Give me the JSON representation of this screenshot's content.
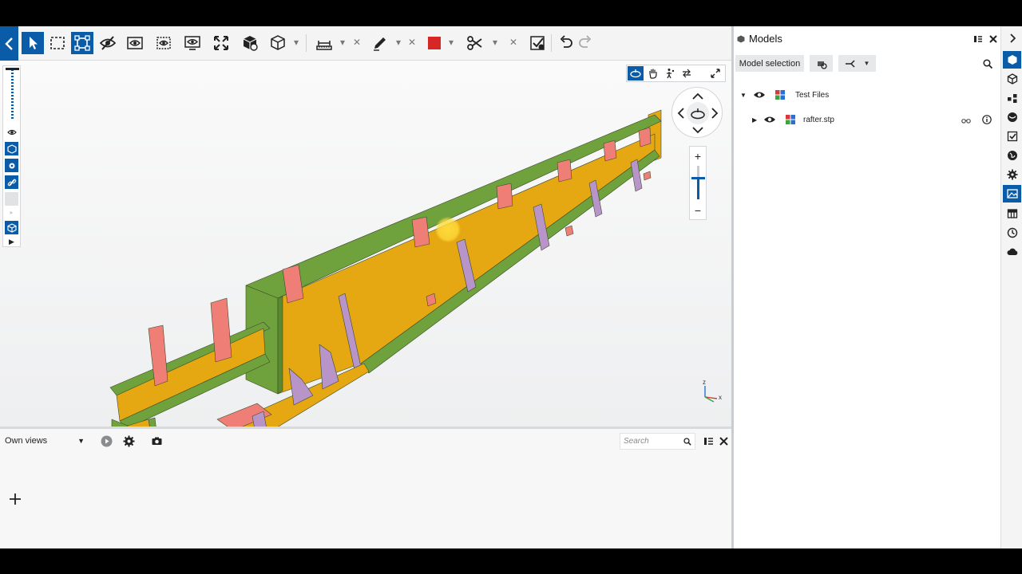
{
  "colors": {
    "accent": "#0a5ca8",
    "flange": "#6fa23c",
    "web": "#e5a812",
    "plate": "#ef7e76",
    "stiffener": "#b895c8",
    "red_swatch": "#d62626"
  },
  "toolbar": {
    "icons": [
      "back-icon",
      "select-arrow-icon",
      "box-select-icon",
      "fit-selection-icon",
      "hide-icon",
      "show-icon",
      "view-icon",
      "isolate-icon",
      "fit-all-icon",
      "model-box-icon",
      "cube-icon",
      "measure-icon",
      "markup-pen-icon",
      "color-swatch-icon",
      "clip-scissors-icon",
      "checked-icon",
      "undo-icon",
      "redo-icon"
    ]
  },
  "viewport": {
    "axis_labels": {
      "z": "z",
      "x": "x"
    },
    "zoom_plus": "+",
    "zoom_minus": "−"
  },
  "views_panel": {
    "selected_view": "Own views",
    "search_placeholder": "Search",
    "add_symbol": "+"
  },
  "models_panel": {
    "title": "Models",
    "model_selection_label": "Model selection",
    "tree": [
      {
        "label": "Test Files",
        "expanded": true,
        "level": 0
      },
      {
        "label": "rafter.stp",
        "expanded": false,
        "level": 1
      }
    ]
  },
  "side_bar": {
    "icons": [
      "models-icon",
      "objects-icon",
      "organizer-icon",
      "layers-icon",
      "clash-icon",
      "globe-icon",
      "settings-icon",
      "views-icon",
      "table-icon",
      "history-icon",
      "cloud-icon"
    ],
    "active": "views-icon"
  }
}
